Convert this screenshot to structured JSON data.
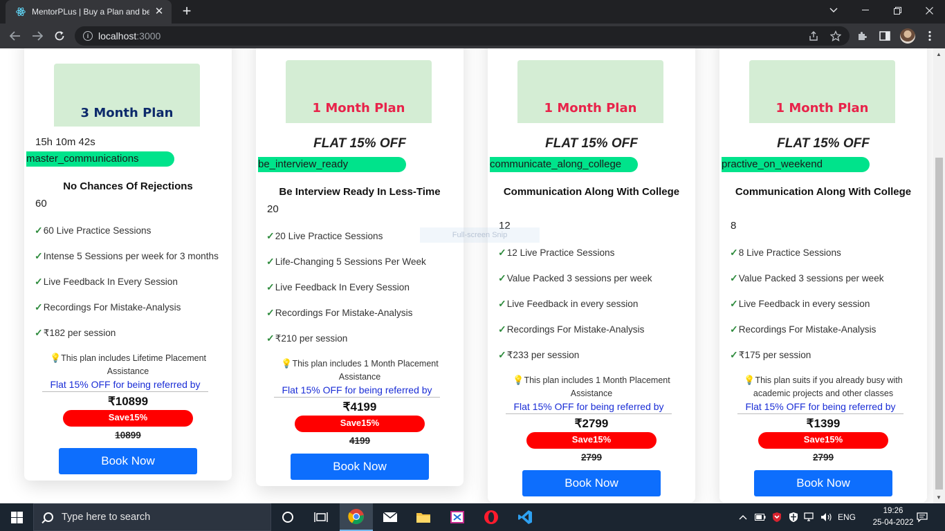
{
  "browser": {
    "tab_title": "MentorPLus | Buy a Plan and be I",
    "tab_close": "✕",
    "new_tab": "+",
    "url_host": "localhost",
    "url_port": ":3000"
  },
  "cards": [
    {
      "plan": "3 Month Plan",
      "plan_color": "#0d2a6b",
      "header_text": "15h 10m 42s",
      "code": "master_communications",
      "title": "No Chances Of Rejections",
      "sessions": "60",
      "features": [
        "60 Live Practice Sessions",
        "Intense 5 Sessions per week for 3 months",
        "Live Feedback In Every Session",
        "Recordings For Mistake-Analysis",
        "₹182 per session"
      ],
      "note": "This plan includes Lifetime Placement Assistance",
      "referral": "Flat 15% OFF for being referred by",
      "price": "₹10899",
      "save": "Save15%",
      "old_price": "10899",
      "button": "Book Now"
    },
    {
      "plan": "1 Month Plan",
      "plan_color": "#e8234a",
      "header_text": "FLAT 15% OFF",
      "code": "be_interview_ready",
      "title": "Be Interview Ready In Less-Time",
      "sessions": "20",
      "features": [
        "20 Live Practice Sessions",
        "Life-Changing 5 Sessions Per Week",
        "Live Feedback In Every Session",
        "Recordings For Mistake-Analysis",
        "₹210 per session"
      ],
      "note": "This plan includes 1 Month Placement Assistance",
      "referral": "Flat 15% OFF for being referred by",
      "price": "₹4199",
      "save": "Save15%",
      "old_price": "4199",
      "button": "Book Now"
    },
    {
      "plan": "1 Month Plan",
      "plan_color": "#e8234a",
      "header_text": "FLAT 15% OFF",
      "code": "communicate_along_college",
      "title": "Communication Along With College",
      "sessions": "12",
      "features": [
        "12 Live Practice Sessions",
        "Value Packed 3 sessions per week",
        "Live Feedback in every session",
        "Recordings For Mistake-Analysis",
        "₹233 per session"
      ],
      "note": "This plan includes 1 Month Placement Assistance",
      "referral": "Flat 15% OFF for being referred by",
      "price": "₹2799",
      "save": "Save15%",
      "old_price": "2799",
      "button": "Book Now"
    },
    {
      "plan": "1 Month Plan",
      "plan_color": "#e8234a",
      "header_text": "FLAT 15% OFF",
      "code": "practive_on_weekend",
      "title": "Communication Along With College",
      "sessions": "8",
      "features": [
        "8 Live Practice Sessions",
        "Value Packed 3 sessions per week",
        "Live Feedback in every session",
        "Recordings For Mistake-Analysis",
        "₹175 per session"
      ],
      "note": "This plan suits if you already busy with academic projects and other classes",
      "referral": "Flat 15% OFF for being referred by",
      "price": "₹1399",
      "save": "Save15%",
      "old_price": "2799",
      "button": "Book Now"
    }
  ],
  "overlay": {
    "snip_text": "Full-screen Snip"
  },
  "taskbar": {
    "search_placeholder": "Type here to search",
    "language": "ENG",
    "time": "19:26",
    "date": "25-04-2022"
  },
  "colors": {
    "accent_green": "#00e38b",
    "save_red": "#ff0000",
    "button_blue": "#0d6efd",
    "plan_box_bg": "#d4edd4",
    "referral_blue": "#1a2dd6"
  }
}
